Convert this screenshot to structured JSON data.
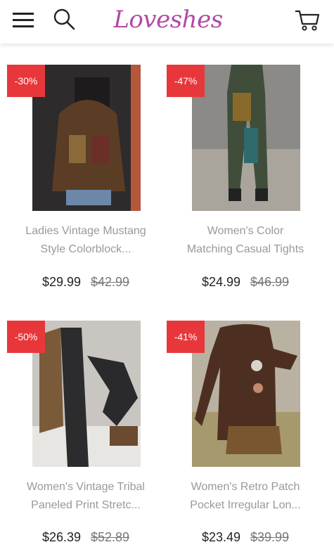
{
  "header": {
    "logo_text": "Loveshes"
  },
  "products": [
    {
      "discount": "-30%",
      "name_line1": "Ladies Vintage Mustang",
      "name_line2": "Style Colorblock...",
      "price": "$29.99",
      "original_price": "$42.99"
    },
    {
      "discount": "-47%",
      "name_line1": "Women's Color",
      "name_line2": "Matching Casual Tights",
      "price": "$24.99",
      "original_price": "$46.99"
    },
    {
      "discount": "-50%",
      "name_line1": "Women's Vintage Tribal",
      "name_line2": "Paneled Print Stretc...",
      "price": "$26.39",
      "original_price": "$52.89"
    },
    {
      "discount": "-41%",
      "name_line1": "Women's Retro Patch",
      "name_line2": "Pocket Irregular Lon...",
      "price": "$23.49",
      "original_price": "$39.99"
    }
  ]
}
